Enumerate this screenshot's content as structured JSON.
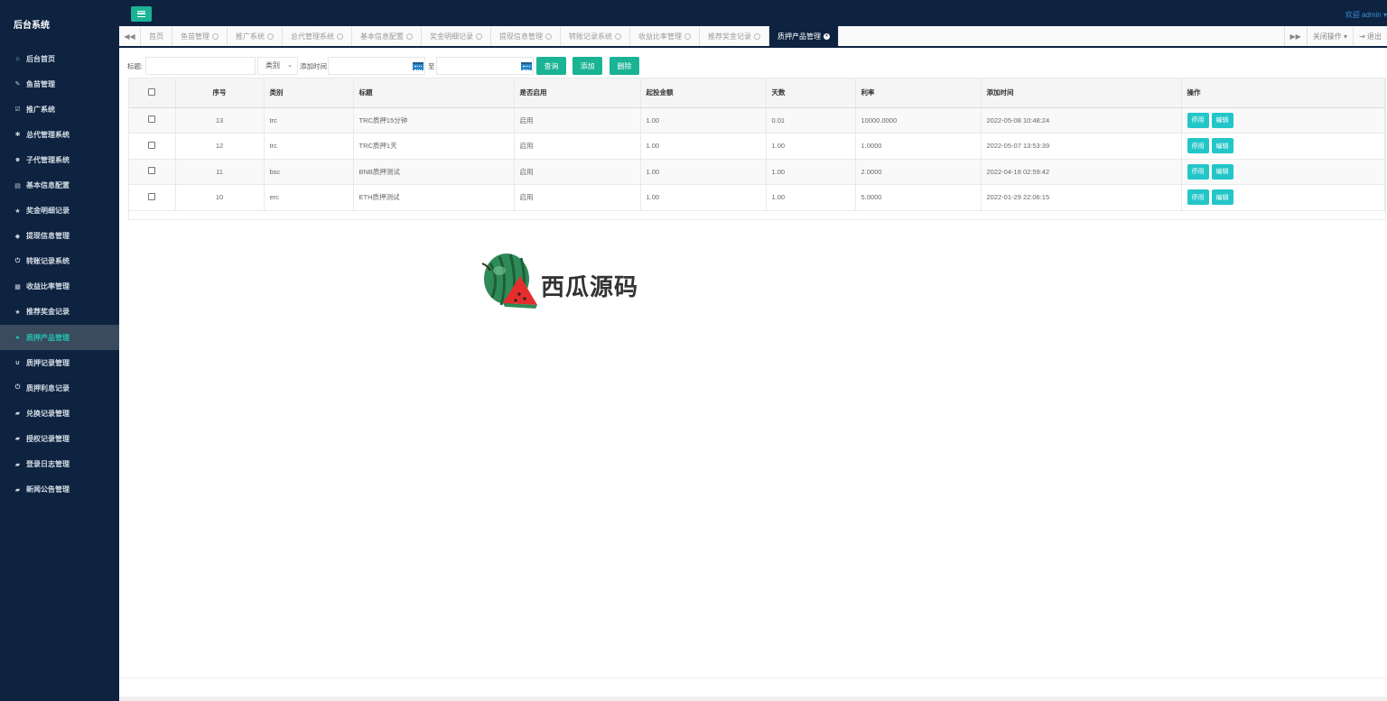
{
  "brand": "后台系统",
  "welcome": "欢迎 admin",
  "sidebar": {
    "items": [
      {
        "icon": "home-icon",
        "glyph": "⌂",
        "label": "后台首页"
      },
      {
        "icon": "wrench-icon",
        "glyph": "✎",
        "label": "鱼苗管理"
      },
      {
        "icon": "edit-icon",
        "glyph": "☑",
        "label": "推广系统"
      },
      {
        "icon": "asterisk-icon",
        "glyph": "✱",
        "label": "总代管理系统"
      },
      {
        "icon": "users-icon",
        "glyph": "☻",
        "label": "子代管理系统"
      },
      {
        "icon": "file-icon",
        "glyph": "▤",
        "label": "基本信息配置"
      },
      {
        "icon": "star-icon",
        "glyph": "★",
        "label": "奖金明细记录"
      },
      {
        "icon": "tag-icon",
        "glyph": "◆",
        "label": "提现信息管理"
      },
      {
        "icon": "power-icon",
        "glyph": "⏻",
        "label": "转账记录系统"
      },
      {
        "icon": "calendar-icon",
        "glyph": "▦",
        "label": "收益比率管理"
      },
      {
        "icon": "star-icon",
        "glyph": "★",
        "label": "推荐奖金记录"
      },
      {
        "icon": "comment-icon",
        "glyph": "●",
        "label": "质押产品管理"
      },
      {
        "icon": "magnet-icon",
        "glyph": "∪",
        "label": "质押记录管理"
      },
      {
        "icon": "power-icon",
        "glyph": "⏻",
        "label": "质押利息记录"
      },
      {
        "icon": "book-icon",
        "glyph": "▰",
        "label": "兑换记录管理"
      },
      {
        "icon": "book-icon",
        "glyph": "▰",
        "label": "授权记录管理"
      },
      {
        "icon": "book-icon",
        "glyph": "▰",
        "label": "登录日志管理"
      },
      {
        "icon": "book-icon",
        "glyph": "▰",
        "label": "新闻公告管理"
      }
    ],
    "active_index": 11
  },
  "tabs": {
    "prev": "◀◀",
    "items": [
      "首页",
      "鱼苗管理",
      "推广系统",
      "总代管理系统",
      "基本信息配置",
      "奖金明细记录",
      "提现信息管理",
      "转账记录系统",
      "收益比率管理",
      "推荐奖金记录",
      "质押产品管理"
    ],
    "next": "▶▶",
    "close_ops": "关闭操作",
    "logout": "退出"
  },
  "toolbar": {
    "title_label": "标题:",
    "category_value": "类别",
    "time_label": "添加时间",
    "to_label": "至",
    "search_btn": "查询",
    "add_btn": "添加",
    "delete_btn": "删除"
  },
  "table": {
    "headers": [
      "序号",
      "类别",
      "标题",
      "是否启用",
      "起投金额",
      "天数",
      "利率",
      "添加时间",
      "操作"
    ],
    "rows": [
      {
        "id": "13",
        "category": "trc",
        "title": "TRC质押15分钟",
        "enabled": "启用",
        "min_amount": "1.00",
        "days": "0.01",
        "rate": "10000.0000",
        "added": "2022-05-08 10:48:24"
      },
      {
        "id": "12",
        "category": "trc",
        "title": "TRC质押1天",
        "enabled": "启用",
        "min_amount": "1.00",
        "days": "1.00",
        "rate": "1.0000",
        "added": "2022-05-07 13:53:39"
      },
      {
        "id": "11",
        "category": "bsc",
        "title": "BNB质押测试",
        "enabled": "启用",
        "min_amount": "1.00",
        "days": "1.00",
        "rate": "2.0000",
        "added": "2022-04-18 02:59:42"
      },
      {
        "id": "10",
        "category": "erc",
        "title": "ETH质押测试",
        "enabled": "启用",
        "min_amount": "1.00",
        "days": "1.00",
        "rate": "5.0000",
        "added": "2022-01-29 22:06:15"
      }
    ],
    "disable_btn": "停用",
    "edit_btn": "编辑"
  },
  "watermark": "西瓜源码",
  "colors": {
    "sidebar": "#0d2340",
    "accent": "#1ab394",
    "action": "#23c6c8",
    "active_text": "#25c0b0"
  }
}
